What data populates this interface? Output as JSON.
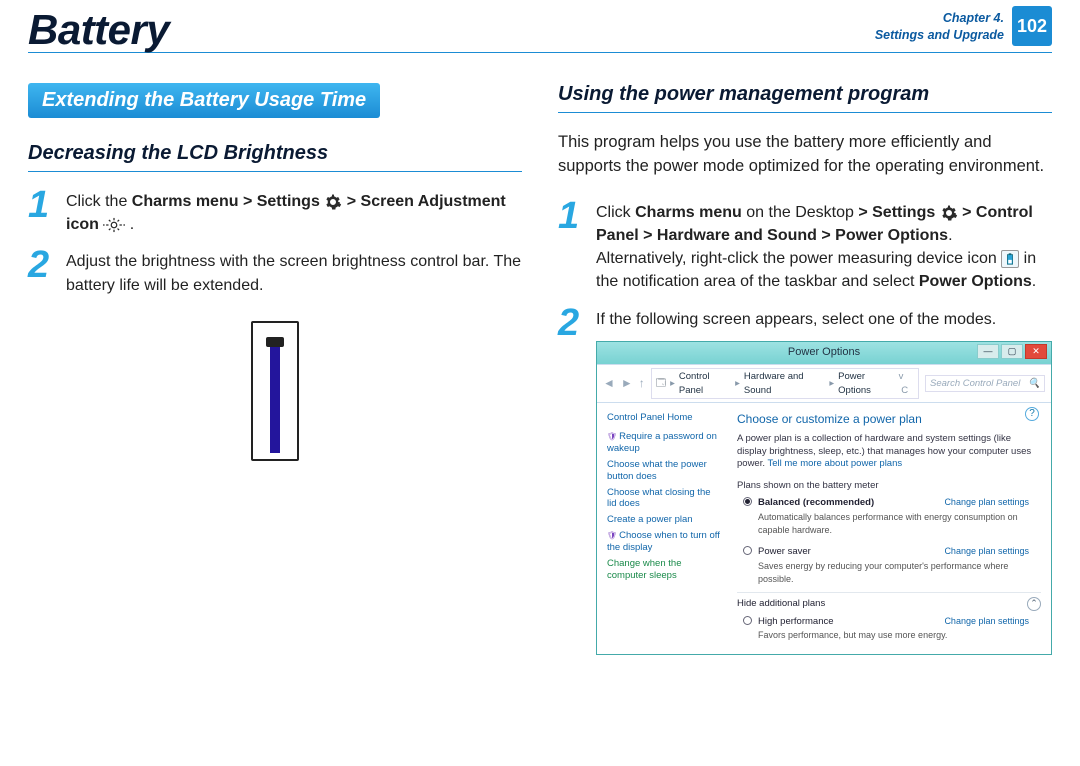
{
  "header": {
    "title": "Battery",
    "chapter_line1": "Chapter 4.",
    "chapter_line2": "Settings and Upgrade",
    "page_number": "102"
  },
  "left": {
    "section_banner": "Extending the Battery Usage Time",
    "subheading": "Decreasing the LCD Brightness",
    "step1": {
      "num": "1",
      "t1": "Click the ",
      "b1": "Charms menu > Settings ",
      "b2": " > Screen Adjustment icon ",
      "t2": " ."
    },
    "step2": {
      "num": "2",
      "text": "Adjust the brightness with the screen brightness control bar. The battery life will be extended."
    }
  },
  "right": {
    "subheading": "Using the power management program",
    "intro": "This program helps you use the battery more efficiently and supports the power mode optimized for the operating environment.",
    "step1": {
      "num": "1",
      "t1": "Click ",
      "b1": "Charms menu",
      "t2": " on the Desktop ",
      "b2": "> Settings ",
      "b3": " > Control Panel > Hardware and Sound > Power Options",
      "t3": ".",
      "alt1": "Alternatively, right-click the power measuring device icon ",
      "alt2": " in the notification area of the taskbar and select ",
      "b4": "Power Options",
      "alt3": "."
    },
    "step2": {
      "num": "2",
      "text": "If the following screen appears, select one of the modes."
    }
  },
  "power_window": {
    "title": "Power Options",
    "breadcrumb": [
      "Control Panel",
      "Hardware and Sound",
      "Power Options"
    ],
    "search_placeholder": "Search Control Panel",
    "side": {
      "home": "Control Panel Home",
      "links": [
        "Require a password on wakeup",
        "Choose what the power button does",
        "Choose what closing the lid does",
        "Create a power plan",
        "Choose when to turn off the display",
        "Change when the computer sleeps"
      ]
    },
    "main": {
      "heading": "Choose or customize a power plan",
      "desc_a": "A power plan is a collection of hardware and system settings (like display brightness, sleep, etc.) that manages how your computer uses power. ",
      "desc_link": "Tell me more about power plans",
      "sect1": "Plans shown on the battery meter",
      "opt1_label_b": "Balanced (recommended)",
      "opt1_sub": "Automatically balances performance with energy consumption on capable hardware.",
      "opt2_label": "Power saver",
      "opt2_sub": "Saves energy by reducing your computer's performance where possible.",
      "hide": "Hide additional plans",
      "opt3_label": "High performance",
      "opt3_sub": "Favors performance, but may use more energy.",
      "change": "Change plan settings"
    }
  }
}
